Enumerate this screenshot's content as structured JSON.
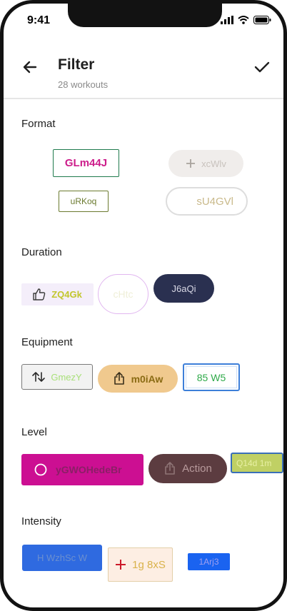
{
  "status": {
    "time": "9:41"
  },
  "appbar": {
    "title": "Filter",
    "subtitle": "28 workouts"
  },
  "sections": {
    "format": {
      "title": "Format",
      "chips": [
        "GLm44J",
        "xcWlv",
        "uRKoq",
        "sU4GVl"
      ]
    },
    "duration": {
      "title": "Duration",
      "chips": [
        "ZQ4Gk",
        "cHtc",
        "J6aQi"
      ]
    },
    "equipment": {
      "title": "Equipment",
      "chips": [
        "GmezY",
        "m0iAw",
        "85 W5"
      ]
    },
    "level": {
      "title": "Level",
      "chips": [
        "yGWOHedeBr",
        "Action",
        "Q14d 1m"
      ]
    },
    "intensity": {
      "title": "Intensity",
      "chips": [
        "H WzhSc W",
        "1g 8xS",
        "1Arj3"
      ]
    }
  },
  "icons": {
    "back": "arrow-left-icon",
    "confirm": "checkmark-icon",
    "add": "plus-icon",
    "like": "thumbs-up-icon",
    "sort": "up-down-arrows-icon",
    "share": "share-icon",
    "radio": "radio-circle-icon"
  }
}
